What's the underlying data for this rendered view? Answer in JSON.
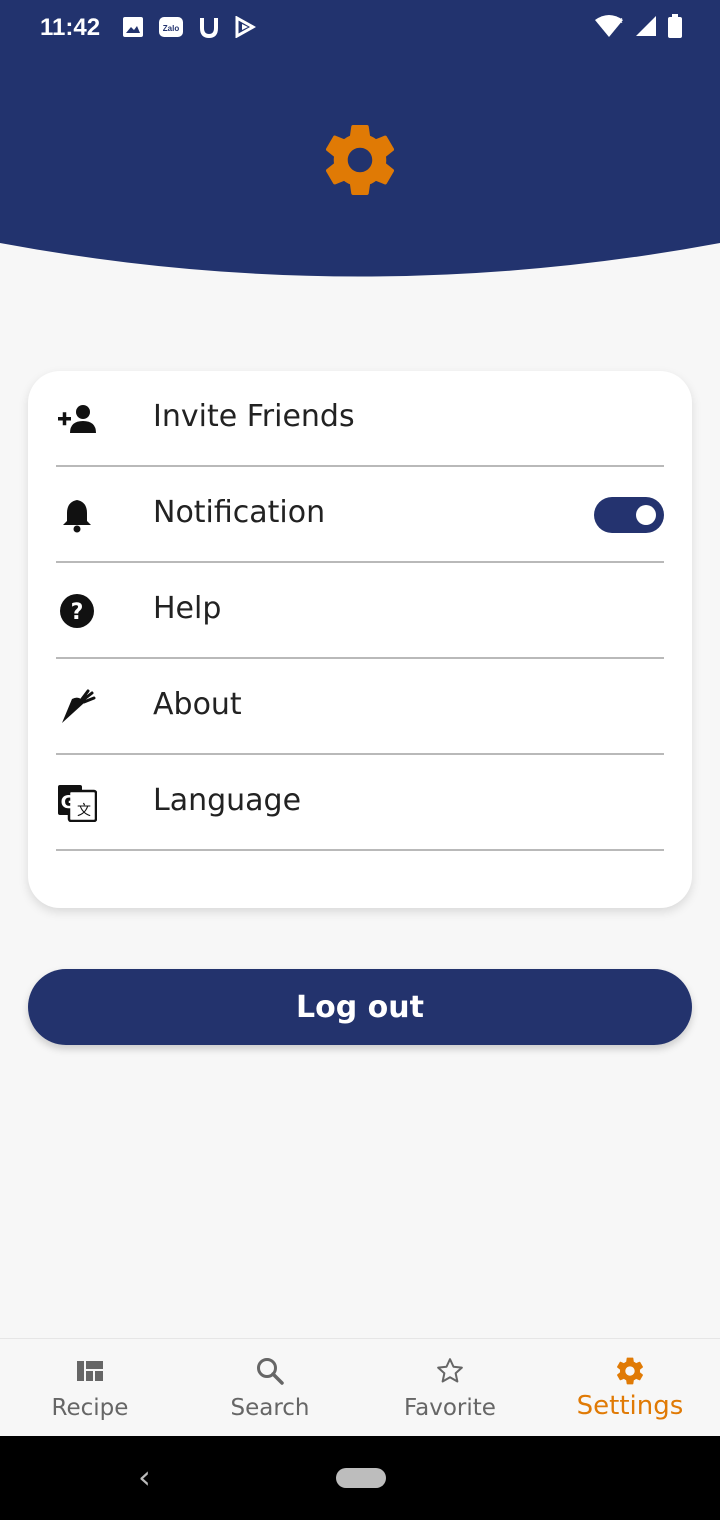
{
  "status_bar": {
    "time": "11:42",
    "icons": [
      "image-icon",
      "zalo-icon",
      "u-icon",
      "play-store-icon"
    ],
    "right_icons": [
      "wifi-icon",
      "signal-icon",
      "battery-icon"
    ]
  },
  "header": {
    "icon": "gear-icon",
    "bg_color": "#22336e",
    "accent_color": "#e07a05"
  },
  "settings": {
    "items": [
      {
        "label": "Invite Friends",
        "icon": "add-person-icon"
      },
      {
        "label": "Notification",
        "icon": "bell-icon",
        "toggle": true
      },
      {
        "label": "Help",
        "icon": "help-icon"
      },
      {
        "label": "About",
        "icon": "carrot-icon"
      },
      {
        "label": "Language",
        "icon": "translate-icon"
      }
    ]
  },
  "logout_label": "Log out",
  "bottom_nav": {
    "items": [
      {
        "label": "Recipe",
        "icon": "dashboard-icon"
      },
      {
        "label": "Search",
        "icon": "search-icon"
      },
      {
        "label": "Favorite",
        "icon": "star-icon"
      },
      {
        "label": "Settings",
        "icon": "gear-icon",
        "active": true
      }
    ]
  }
}
